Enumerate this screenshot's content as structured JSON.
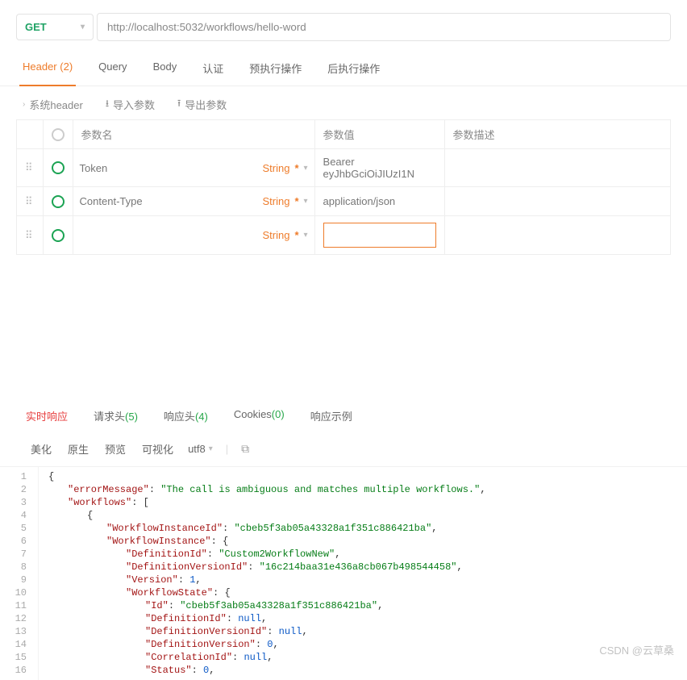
{
  "request": {
    "method": "GET",
    "url": "http://localhost:5032/workflows/hello-word"
  },
  "tabs": {
    "header": {
      "label": "Header",
      "count": "(2)"
    },
    "query": "Query",
    "body": "Body",
    "auth": "认证",
    "preop": "预执行操作",
    "postop": "后执行操作"
  },
  "sub": {
    "sys": "系统header",
    "imp": "导入参数",
    "exp": "导出参数"
  },
  "cols": {
    "name": "参数名",
    "value": "参数值",
    "desc": "参数描述"
  },
  "type_label": "String",
  "rows": [
    {
      "name": "Token",
      "value": "Bearer eyJhbGciOiJIUzI1N"
    },
    {
      "name": "Content-Type",
      "value": "application/json"
    },
    {
      "name": "",
      "value": ""
    }
  ],
  "resp_tabs": {
    "live": "实时响应",
    "rh": {
      "label": "请求头",
      "count": "(5)"
    },
    "sh": {
      "label": "响应头",
      "count": "(4)"
    },
    "ck": {
      "label": "Cookies",
      "count": "(0)"
    },
    "ex": "响应示例"
  },
  "resp_tools": {
    "fmt": "美化",
    "raw": "原生",
    "prev": "预览",
    "vis": "可视化",
    "enc": "utf8"
  },
  "json": {
    "l1": "{",
    "l2_k": "\"errorMessage\"",
    "l2_v": "\"The call is ambiguous and matches multiple workflows.\"",
    "l3_k": "\"workflows\"",
    "l3_v": "[",
    "l4": "{",
    "l5_k": "\"WorkflowInstanceId\"",
    "l5_v": "\"cbeb5f3ab05a43328a1f351c886421ba\"",
    "l6_k": "\"WorkflowInstance\"",
    "l6_v": "{",
    "l7_k": "\"DefinitionId\"",
    "l7_v": "\"Custom2WorkflowNew\"",
    "l8_k": "\"DefinitionVersionId\"",
    "l8_v": "\"16c214baa31e436a8cb067b498544458\"",
    "l9_k": "\"Version\"",
    "l9_v": "1",
    "l10_k": "\"WorkflowState\"",
    "l10_v": "{",
    "l11_k": "\"Id\"",
    "l11_v": "\"cbeb5f3ab05a43328a1f351c886421ba\"",
    "l12_k": "\"DefinitionId\"",
    "l12_v": "null",
    "l13_k": "\"DefinitionVersionId\"",
    "l13_v": "null",
    "l14_k": "\"DefinitionVersion\"",
    "l14_v": "0",
    "l15_k": "\"CorrelationId\"",
    "l15_v": "null",
    "l16_k": "\"Status\"",
    "l16_v": "0"
  },
  "watermark": "CSDN @云草桑"
}
